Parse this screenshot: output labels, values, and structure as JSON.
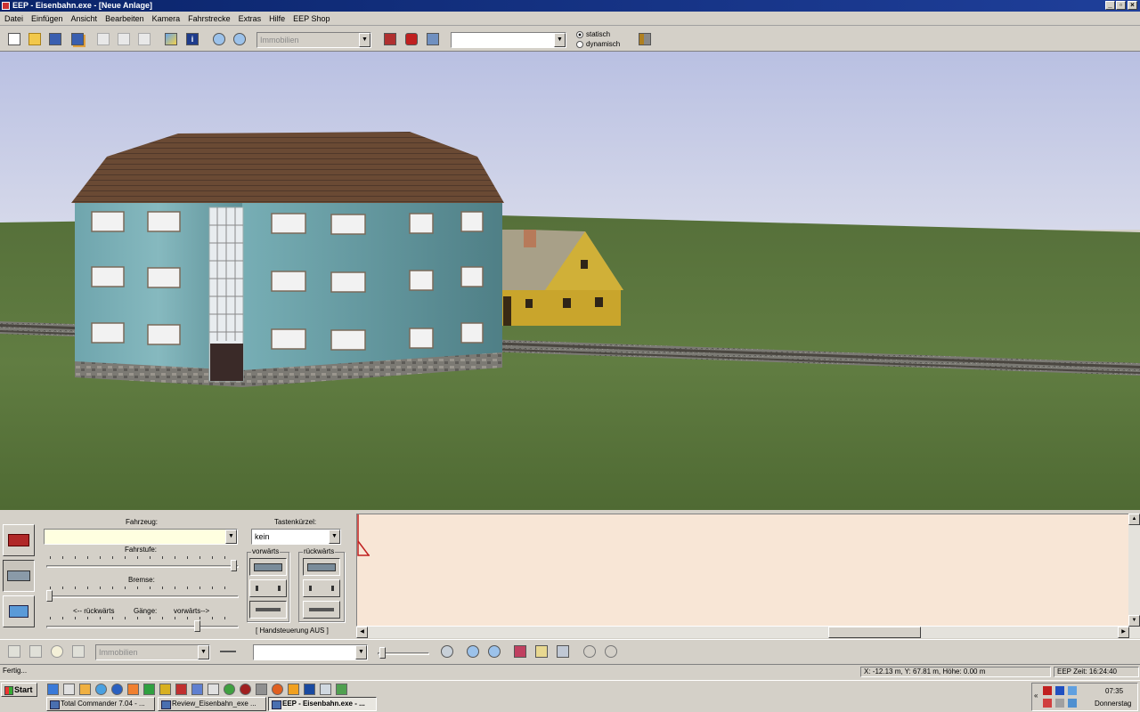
{
  "window": {
    "title": "EEP - Eisenbahn.exe - [Neue Anlage]"
  },
  "menu": [
    "Datei",
    "Einfügen",
    "Ansicht",
    "Bearbeiten",
    "Kamera",
    "Fahrstrecke",
    "Extras",
    "Hilfe",
    "EEP Shop"
  ],
  "toolbar": {
    "category_combo": "Immobilien",
    "object_combo": "",
    "radio_static": "statisch",
    "radio_dynamic": "dynamisch",
    "radio_selected": "statisch",
    "icons": [
      "new-file-icon",
      "open-folder-icon",
      "save-icon",
      "save-all-icon",
      "cut-icon",
      "copy-icon",
      "paste-icon",
      "layer-icon",
      "info-icon",
      "zoom-in-icon",
      "zoom-out-icon",
      "locomotive-icon",
      "signal-icon",
      "switch-icon",
      "tools-icon"
    ]
  },
  "control_panel": {
    "vehicle_label": "Fahrzeug:",
    "vehicle_value": "",
    "shortcut_label": "Tastenkürzel:",
    "shortcut_value": "kein",
    "speed_label": "Fahrstufe:",
    "brake_label": "Bremse:",
    "reverse_label": "<-- rückwärts",
    "gears_label": "Gänge:",
    "forward_label": "vorwärts-->",
    "forward_group": "vorwärts",
    "backward_group": "rückwärts",
    "manual_control": "[ Handsteuerung AUS ]"
  },
  "bottom_toolbar": {
    "category_combo": "Immobilien",
    "object_combo": ""
  },
  "statusbar": {
    "status": "Fertig...",
    "coordinates": "X: -12.13 m, Y: 67.81 m, Höhe: 0.00 m",
    "eep_time": "EEP Zeit: 16:24:40"
  },
  "taskbar": {
    "start": "Start",
    "tasks": [
      "Total Commander 7.04 - ...",
      "Review_Eisenbahn_exe ...",
      "EEP - Eisenbahn.exe - ..."
    ],
    "active_task_index": 2,
    "clock": "07:35",
    "day": "Donnerstag",
    "tray_chevron": "«"
  },
  "colors": {
    "titlebar": "#0a246a",
    "sky": "#c8cde8",
    "grass": "#5e7a3e",
    "output_bg": "#f8e6d6"
  }
}
